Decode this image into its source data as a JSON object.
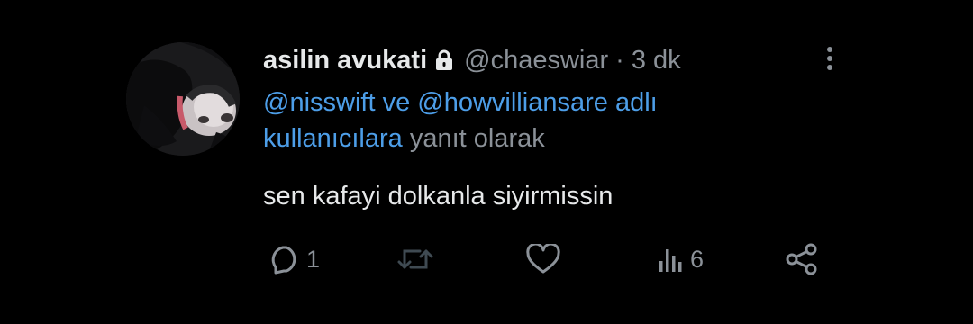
{
  "tweet": {
    "display_name": "asilin avukati",
    "handle": "@chaeswiar",
    "separator": "·",
    "time": "3 dk",
    "reply": {
      "mention_1": "@nisswift",
      "connector": "ve",
      "mention_2": "@howvilliansare",
      "suffix_linked": "adlı kullanıcılara",
      "suffix_plain": "yanıt olarak"
    },
    "text": "sen kafayi dolkanla siyirmissin",
    "actions": {
      "reply_count": "1",
      "retweet_count": "",
      "like_count": "",
      "views_count": "6"
    }
  },
  "colors": {
    "background": "#000000",
    "primary_text": "#e7e9ea",
    "secondary_text": "#8b9198",
    "link": "#4d9ee8"
  },
  "icons": [
    "lock-icon",
    "more-icon",
    "reply-icon",
    "retweet-icon",
    "like-icon",
    "views-icon",
    "share-icon"
  ]
}
